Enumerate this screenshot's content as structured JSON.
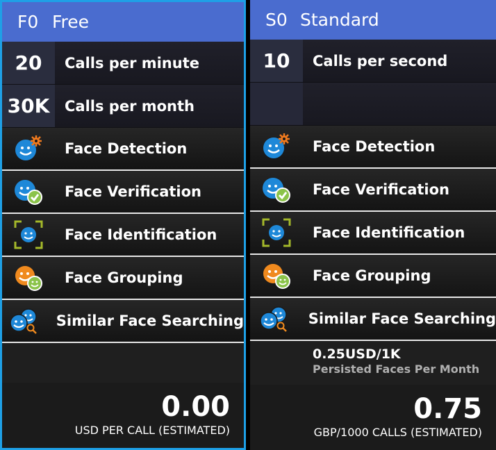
{
  "tiers": [
    {
      "code": "F0",
      "name": "Free",
      "selected": true,
      "quotas": [
        {
          "value": "20",
          "label": "Calls per minute"
        },
        {
          "value": "30K",
          "label": "Calls per month"
        }
      ],
      "features": [
        {
          "icon": "face-detection-icon",
          "label": "Face Detection"
        },
        {
          "icon": "face-verification-icon",
          "label": "Face Verification"
        },
        {
          "icon": "face-identification-icon",
          "label": "Face Identification"
        },
        {
          "icon": "face-grouping-icon",
          "label": "Face Grouping"
        },
        {
          "icon": "similar-face-search-icon",
          "label": "Similar Face Searching"
        }
      ],
      "extra": {
        "price": "",
        "desc": ""
      },
      "price": {
        "value": "0.00",
        "unit": "USD PER CALL (ESTIMATED)"
      }
    },
    {
      "code": "S0",
      "name": "Standard",
      "selected": false,
      "quotas": [
        {
          "value": "10",
          "label": "Calls per second"
        },
        {
          "value": "",
          "label": ""
        }
      ],
      "features": [
        {
          "icon": "face-detection-icon",
          "label": "Face Detection"
        },
        {
          "icon": "face-verification-icon",
          "label": "Face Verification"
        },
        {
          "icon": "face-identification-icon",
          "label": "Face Identification"
        },
        {
          "icon": "face-grouping-icon",
          "label": "Face Grouping"
        },
        {
          "icon": "similar-face-search-icon",
          "label": "Similar Face Searching"
        }
      ],
      "extra": {
        "price": "0.25USD/1K",
        "desc": "Persisted Faces Per Month"
      },
      "price": {
        "value": "0.75",
        "unit": "GBP/1000 CALLS (ESTIMATED)"
      }
    }
  ],
  "colors": {
    "selected_border": "#1ea0e6",
    "header_bg": "#4a6ccf",
    "face_blue": "#1e88d8",
    "face_orange": "#f08a1e",
    "check_green": "#8bc34a",
    "gear_orange": "#f07a1e",
    "bracket_green": "#a4b82a"
  }
}
